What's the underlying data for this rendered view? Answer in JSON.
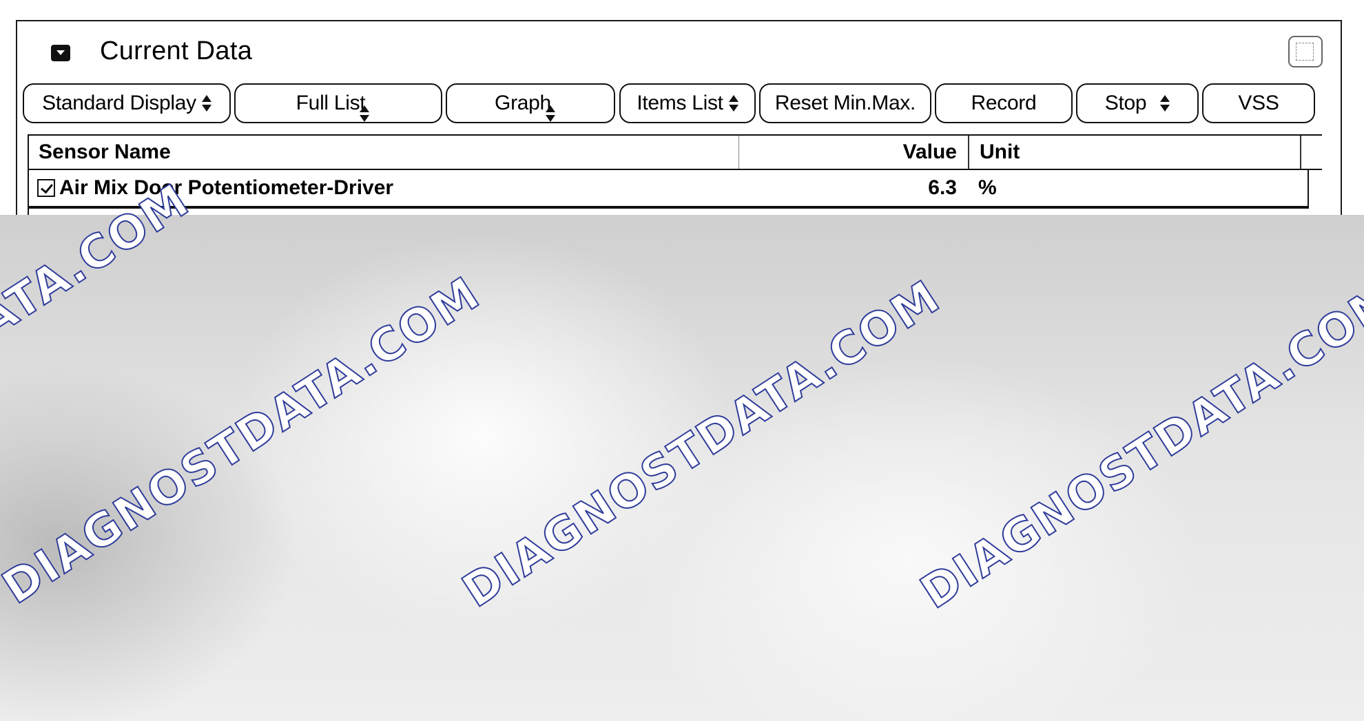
{
  "panel": {
    "title": "Current Data",
    "collapse_icon": "collapse-toggle-icon",
    "window_icon": "window-restore-icon"
  },
  "toolbar": {
    "standard_display": "Standard Display",
    "full_list": "Full List",
    "graph": "Graph",
    "items_list": "Items List",
    "reset_min_max": "Reset Min.Max.",
    "record": "Record",
    "stop": "Stop",
    "vss": "VSS"
  },
  "table": {
    "headers": {
      "name": "Sensor Name",
      "value": "Value",
      "unit": "Unit"
    },
    "rows": [
      {
        "checked": true,
        "name": "Air Mix Door Potentiometer-Driver",
        "value": "6.3",
        "unit": "%"
      }
    ]
  },
  "watermark": {
    "text": "DIAGNOSTDATA.COM",
    "color": "#2f3c9a"
  }
}
